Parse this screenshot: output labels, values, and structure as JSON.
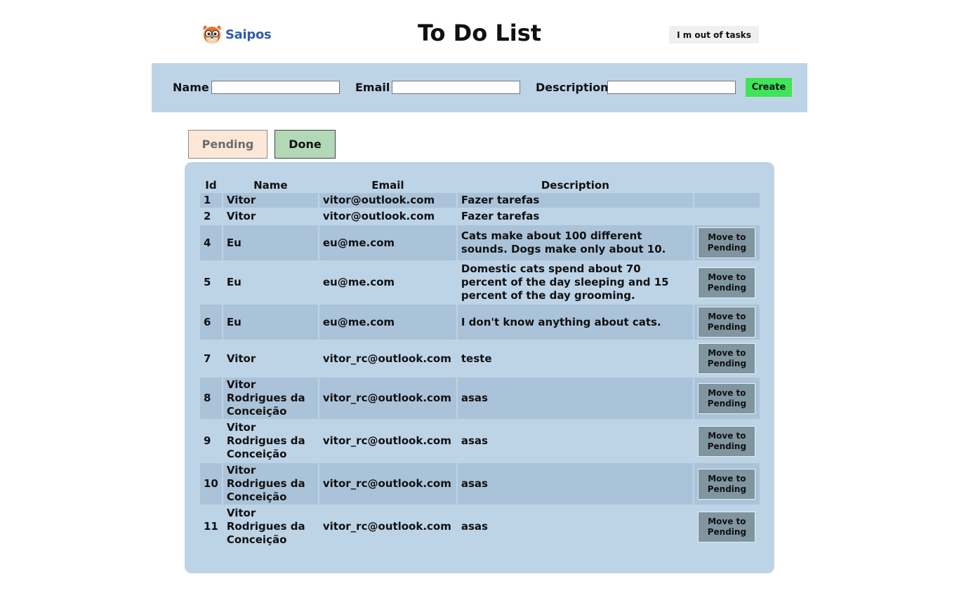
{
  "header": {
    "logo_text": "Saipos",
    "title": "To Do List",
    "out_of_tasks_label": "I m out of tasks"
  },
  "form": {
    "name_label": "Name",
    "name_value": "",
    "email_label": "Email",
    "email_value": "",
    "description_label": "Description",
    "description_value": "",
    "create_label": "Create"
  },
  "tabs": {
    "pending_label": "Pending",
    "done_label": "Done",
    "active": "Done"
  },
  "table": {
    "headers": {
      "id": "Id",
      "name": "Name",
      "email": "Email",
      "description": "Description"
    },
    "move_label": "Move to Pending",
    "rows": [
      {
        "id": "1",
        "name": "Vitor",
        "email": "vitor@outlook.com",
        "description": "Fazer tarefas",
        "has_action": false
      },
      {
        "id": "2",
        "name": "Vitor",
        "email": "vitor@outlook.com",
        "description": "Fazer tarefas",
        "has_action": false
      },
      {
        "id": "4",
        "name": "Eu",
        "email": "eu@me.com",
        "description": "Cats make about 100 different sounds. Dogs make only about 10.",
        "has_action": true
      },
      {
        "id": "5",
        "name": "Eu",
        "email": "eu@me.com",
        "description": "Domestic cats spend about 70 percent of the day sleeping and 15 percent of the day grooming.",
        "has_action": true
      },
      {
        "id": "6",
        "name": "Eu",
        "email": "eu@me.com",
        "description": "I don't know anything about cats.",
        "has_action": true
      },
      {
        "id": "7",
        "name": "Vitor",
        "email": "vitor_rc@outlook.com",
        "description": "teste",
        "has_action": true
      },
      {
        "id": "8",
        "name": "Vitor Rodrigues da Conceição",
        "email": "vitor_rc@outlook.com",
        "description": "asas",
        "has_action": true
      },
      {
        "id": "9",
        "name": "Vitor Rodrigues da Conceição",
        "email": "vitor_rc@outlook.com",
        "description": "asas",
        "has_action": true
      },
      {
        "id": "10",
        "name": "Vitor Rodrigues da Conceição",
        "email": "vitor_rc@outlook.com",
        "description": "asas",
        "has_action": true
      },
      {
        "id": "11",
        "name": "Vitor Rodrigues da Conceição",
        "email": "vitor_rc@outlook.com",
        "description": "asas",
        "has_action": true
      }
    ]
  },
  "colors": {
    "form_background": "#bdd4e7",
    "create_button": "#3ee45a",
    "pending_tab": "#fde8d8",
    "done_tab": "#b2d8b6",
    "move_button": "#7f959f",
    "logo_text": "#2f5da8"
  },
  "icons": {
    "logo": "squirrel-logo-icon"
  }
}
